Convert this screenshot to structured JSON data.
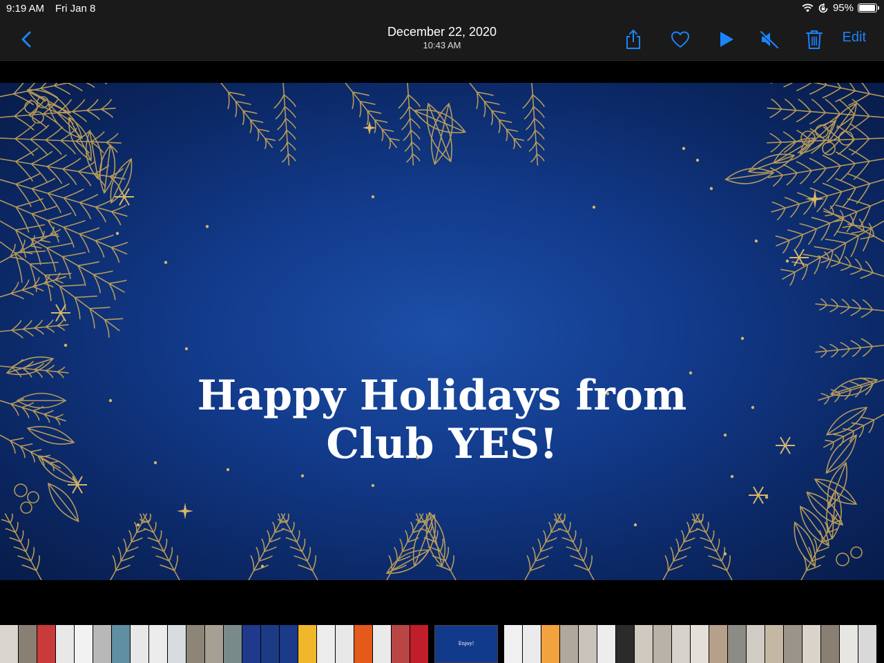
{
  "status_bar": {
    "time": "9:19 AM",
    "date": "Fri Jan 8",
    "battery": "95%",
    "battery_level": 0.95,
    "icons": [
      "wifi-icon",
      "orientation-lock-icon",
      "battery-icon"
    ]
  },
  "nav": {
    "date": "December 22, 2020",
    "time": "10:43 AM",
    "edit_label": "Edit",
    "accent": "#1a84ff",
    "icons": [
      "back-chevron-icon",
      "share-icon",
      "heart-icon",
      "play-icon",
      "mute-icon",
      "trash-icon"
    ]
  },
  "media": {
    "headline_line1": "Happy Holidays from",
    "headline_line2": "Club YES!",
    "background_color": "#123a8a",
    "ornament_color": "#c9a75a"
  },
  "filmstrip": {
    "current_caption": "Enjoy!",
    "thumb_colors": [
      "#d9d6d0",
      "#8a7f73",
      "#c93a3a",
      "#e8e8e8",
      "#f2f2f2",
      "#b8b8b8",
      "#5f8fa0",
      "#e8e8e8",
      "#ececec",
      "#d8dbe0",
      "#8d8578",
      "#a6a094",
      "#7a8a8a",
      "#1f3a8a",
      "#1d3b85",
      "#1b3a8a",
      "#f0b72a",
      "#ededed",
      "#e7e7e7",
      "#e45a1a",
      "#eaeaea",
      "#b94545",
      "#c01e2a",
      "#f0f0f0",
      "#ebebeb",
      "#f2a340",
      "#b0a89a",
      "#c9c3bb",
      "#ededed",
      "#2b2b2b",
      "#cfc9bf",
      "#b9b2a6",
      "#d6d2cc",
      "#e3e0da",
      "#b7a08a",
      "#8c8b86",
      "#d0ccc4",
      "#c4b8a4",
      "#9a948a",
      "#d9d3c9",
      "#8a7f73",
      "#e8e6e2",
      "#d9d9d9"
    ]
  }
}
